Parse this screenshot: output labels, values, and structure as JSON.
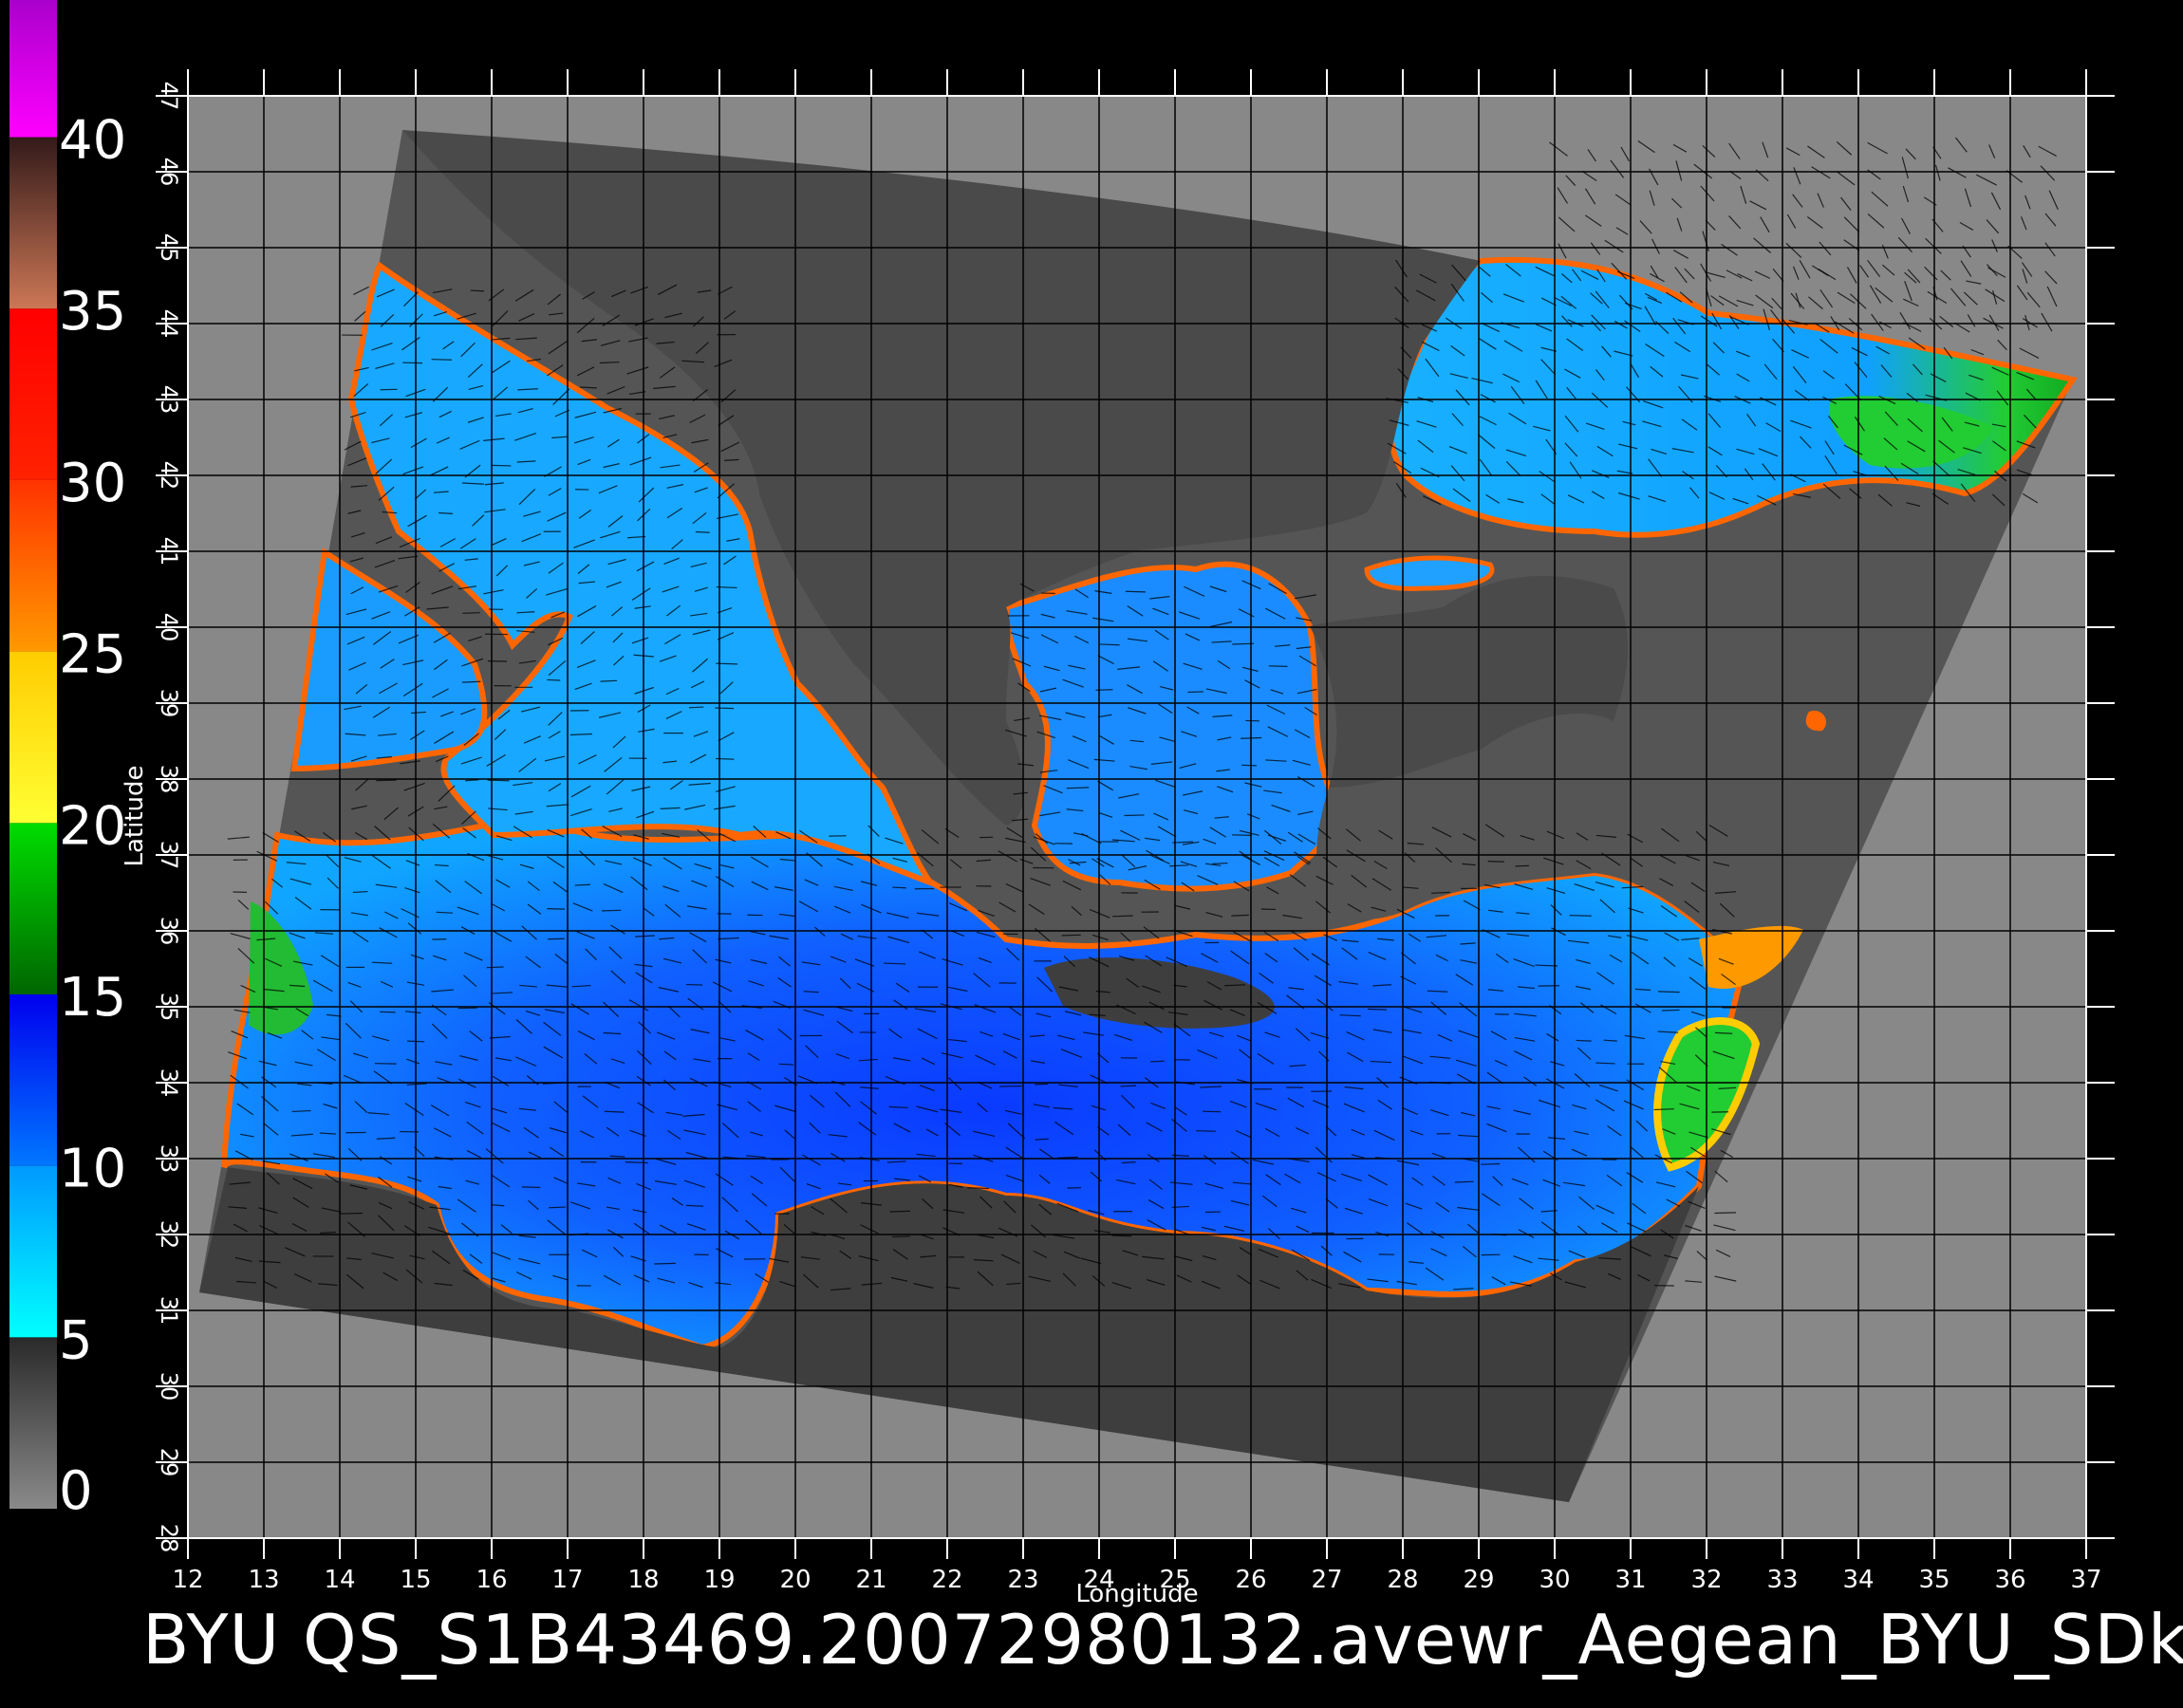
{
  "colorbar": {
    "labels": [
      "0",
      "5",
      "10",
      "15",
      "20",
      "25",
      "30",
      "35",
      "40"
    ],
    "stops": [
      {
        "from": 0,
        "to": 5,
        "colors": [
          "#8a8a8a",
          "#2a2a2a"
        ]
      },
      {
        "from": 5,
        "to": 10,
        "colors": [
          "#00ffff",
          "#0099ff"
        ]
      },
      {
        "from": 10,
        "to": 15,
        "colors": [
          "#0077ff",
          "#0000ee"
        ]
      },
      {
        "from": 15,
        "to": 20,
        "colors": [
          "#006600",
          "#00dd00"
        ]
      },
      {
        "from": 20,
        "to": 25,
        "colors": [
          "#ffff33",
          "#ffcc00"
        ]
      },
      {
        "from": 25,
        "to": 30,
        "colors": [
          "#ff9900",
          "#ff3300"
        ]
      },
      {
        "from": 30,
        "to": 35,
        "colors": [
          "#ff2200",
          "#ff0000"
        ]
      },
      {
        "from": 35,
        "to": 40,
        "colors": [
          "#cc7755",
          "#331a1a"
        ]
      },
      {
        "from": 40,
        "to": 44,
        "colors": [
          "#ff00ff",
          "#aa00cc"
        ]
      }
    ]
  },
  "map": {
    "lon_range": [
      12,
      37
    ],
    "lat_range": [
      28,
      47
    ],
    "lon_ticks": [
      "12",
      "13",
      "14",
      "15",
      "16",
      "17",
      "18",
      "19",
      "20",
      "21",
      "22",
      "23",
      "24",
      "25",
      "26",
      "27",
      "28",
      "29",
      "30",
      "31",
      "32",
      "33",
      "34",
      "35",
      "36",
      "37"
    ],
    "lat_ticks": [
      "28",
      "29",
      "30",
      "31",
      "32",
      "33",
      "34",
      "35",
      "36",
      "37",
      "38",
      "39",
      "40",
      "41",
      "42",
      "43",
      "44",
      "45",
      "46",
      "47"
    ],
    "xlabel": "Longitude",
    "ylabel": "Latitude",
    "background_color": "#888888",
    "swath_color": "#555555",
    "land_color": "#3e3e3e",
    "grid_color": "#000000"
  },
  "caption": "BYU  QS_S1B43469.20072980132.avewr_Aegean_BYU_SDk"
}
